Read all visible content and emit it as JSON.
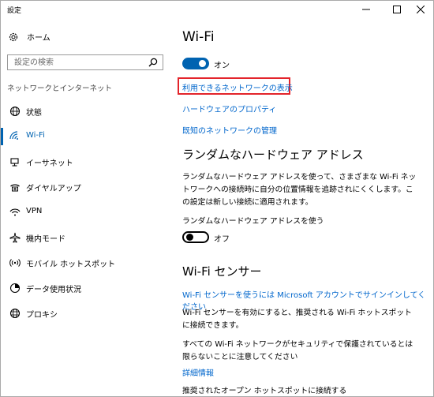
{
  "window": {
    "title": "設定"
  },
  "sidebar": {
    "home_label": "ホーム",
    "search_placeholder": "設定の検索",
    "section_label": "ネットワークとインターネット",
    "items": [
      {
        "label": "状態",
        "icon": "globe-status-icon"
      },
      {
        "label": "Wi-Fi",
        "icon": "wifi-icon",
        "selected": true
      },
      {
        "label": "イーサネット",
        "icon": "ethernet-icon"
      },
      {
        "label": "ダイヤルアップ",
        "icon": "dialup-icon"
      },
      {
        "label": "VPN",
        "icon": "vpn-icon"
      },
      {
        "label": "機内モード",
        "icon": "airplane-icon"
      },
      {
        "label": "モバイル ホットスポット",
        "icon": "hotspot-icon"
      },
      {
        "label": "データ使用状況",
        "icon": "data-usage-icon"
      },
      {
        "label": "プロキシ",
        "icon": "proxy-globe-icon"
      }
    ]
  },
  "main": {
    "title": "Wi-Fi",
    "wifi_toggle": {
      "state": "on",
      "label": "オン"
    },
    "links": {
      "show_networks": "利用できるネットワークの表示",
      "hardware_properties": "ハードウェアのプロパティ",
      "manage_known": "既知のネットワークの管理"
    },
    "random_hw": {
      "heading": "ランダムなハードウェア アドレス",
      "description": "ランダムなハードウェア アドレスを使って、さまざまな Wi-Fi ネットワークへの接続時に自分の位置情報を追跡されにくくします。この設定は新しい接続に適用されます。",
      "setting_label": "ランダムなハードウェア アドレスを使う",
      "toggle_state": "off",
      "toggle_label": "オフ"
    },
    "sense": {
      "heading": "Wi-Fi センサー",
      "signin_link": "Wi-Fi センサーを使うには Microsoft アカウントでサインインしてください",
      "description1": "Wi-Fi センサーを有効にすると、推奨される Wi-Fi ホットスポットに接続できます。",
      "description2": "すべての Wi-Fi ネットワークがセキュリティで保護されているとは限らないことに注意してください",
      "details_link": "詳細情報",
      "open_hotspots_label": "推奨されたオープン ホットスポットに接続する"
    }
  },
  "colors": {
    "accent": "#0063b1",
    "link": "#0066cc",
    "highlight": "#e3242b"
  }
}
